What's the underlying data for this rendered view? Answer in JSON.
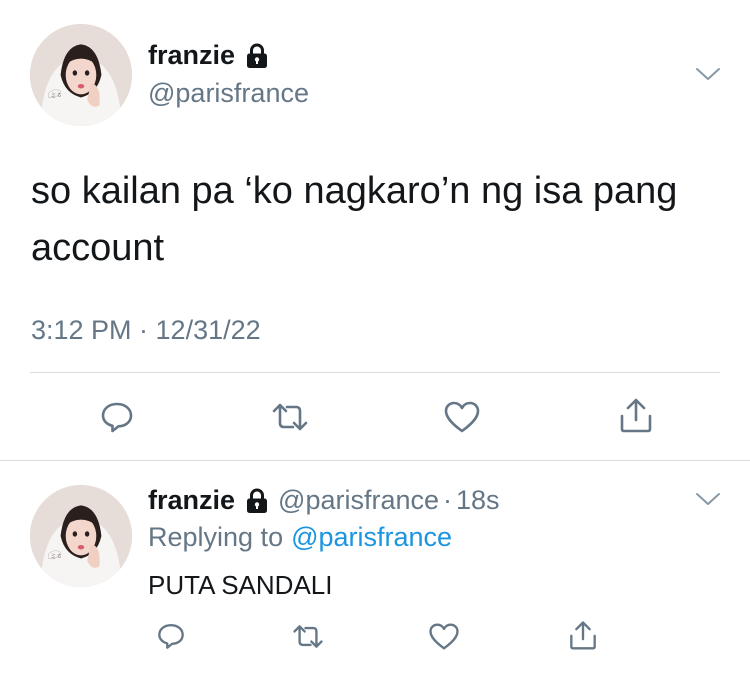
{
  "main_tweet": {
    "display_name": "franzie",
    "handle": "@parisfrance",
    "text": "so kailan pa ‘ko nagkaro’n ng isa pang account",
    "timestamp": "3:12 PM · 12/31/22",
    "icons": {
      "lock": "lock-icon",
      "menu": "chevron-down-icon",
      "reply": "reply-icon",
      "retweet": "retweet-icon",
      "like": "heart-icon",
      "share": "share-icon"
    }
  },
  "reply_tweet": {
    "display_name": "franzie",
    "handle": "@parisfrance",
    "separator": "·",
    "time": "18s",
    "replying_to_label": "Replying to",
    "replying_to_handle": "@parisfrance",
    "text": "PUTA SANDALI"
  },
  "colors": {
    "text_primary": "#14171a",
    "text_secondary": "#657786",
    "link": "#1b95e0",
    "divider": "#d6dde3",
    "icon": "#657786"
  }
}
